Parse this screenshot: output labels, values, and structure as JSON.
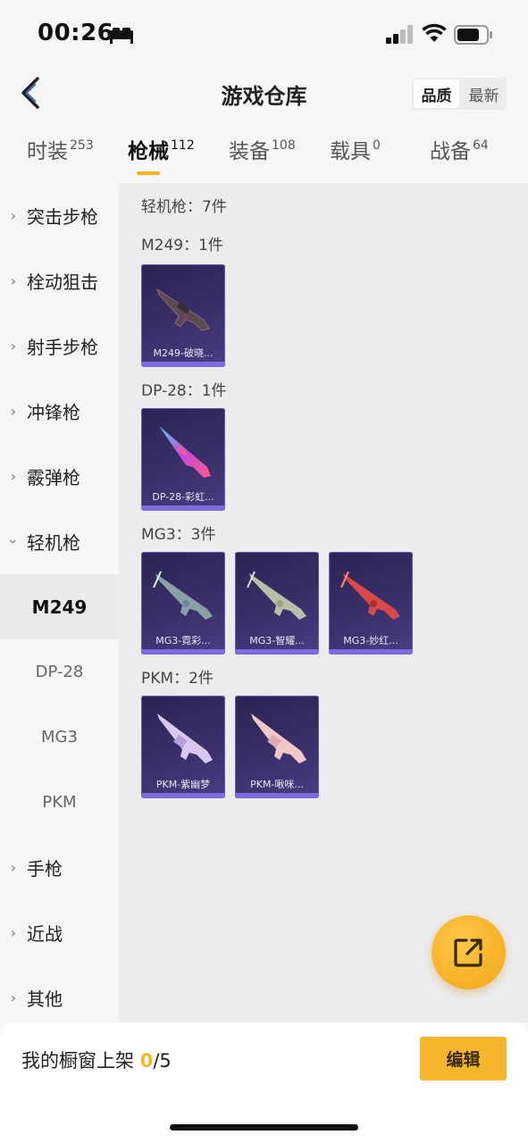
{
  "status": {
    "time": "00:26"
  },
  "header": {
    "title": "游戏仓库",
    "sort": [
      "品质",
      "最新"
    ]
  },
  "tabs": [
    {
      "label": "时装",
      "count": "253"
    },
    {
      "label": "枪械",
      "count": "112"
    },
    {
      "label": "装备",
      "count": "108"
    },
    {
      "label": "载具",
      "count": "0"
    },
    {
      "label": "战备",
      "count": "64"
    }
  ],
  "sidebar": {
    "categories": [
      "突击步枪",
      "栓动狙击",
      "射手步枪",
      "冲锋枪",
      "霰弹枪",
      "轻机枪",
      "手枪",
      "近战",
      "其他"
    ],
    "subitems": [
      "M249",
      "DP-28",
      "MG3",
      "PKM"
    ]
  },
  "content": {
    "summary": "轻机枪：7件",
    "groups": [
      {
        "title": "M249：1件",
        "items": [
          "M249-破晓..."
        ]
      },
      {
        "title": "DP-28：1件",
        "items": [
          "DP-28-彩虹..."
        ]
      },
      {
        "title": "MG3：3件",
        "items": [
          "MG3-霓彩...",
          "MG3-智耀...",
          "MG3-妙红..."
        ]
      },
      {
        "title": "PKM：2件",
        "items": [
          "PKM-紫幽梦",
          "PKM-啾咪..."
        ]
      }
    ]
  },
  "footer": {
    "label": "我的橱窗上架 ",
    "current": "0",
    "total": "/5",
    "edit": "编辑"
  },
  "colors": {
    "accent": "#f5b529",
    "card": "#3a2f6a"
  }
}
